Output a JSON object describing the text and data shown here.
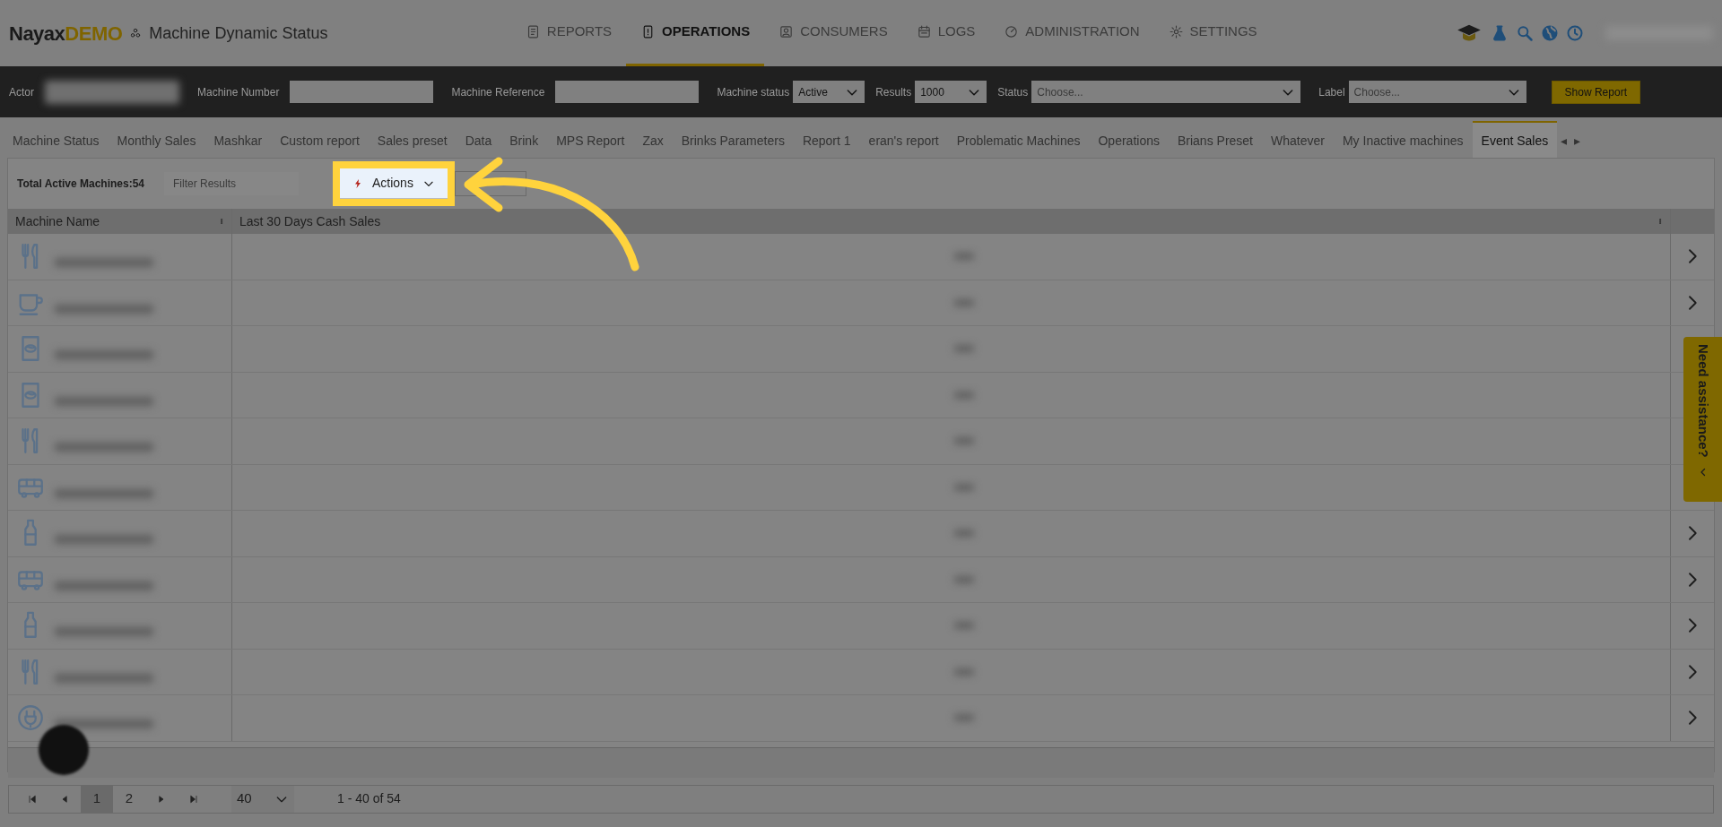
{
  "brand": {
    "name": "Nayax",
    "suffix": "DEMO"
  },
  "page_title": "Machine Dynamic Status",
  "nav": [
    {
      "label": "REPORTS",
      "kind": "doc",
      "selected": false
    },
    {
      "label": "OPERATIONS",
      "kind": "tablet",
      "selected": true
    },
    {
      "label": "CONSUMERS",
      "kind": "person",
      "selected": false
    },
    {
      "label": "LOGS",
      "kind": "calendar",
      "selected": false
    },
    {
      "label": "ADMINISTRATION",
      "kind": "gauge",
      "selected": false
    },
    {
      "label": "SETTINGS",
      "kind": "gear",
      "selected": false
    }
  ],
  "filters": {
    "actor_label": "Actor",
    "machine_number_label": "Machine Number",
    "machine_reference_label": "Machine Reference",
    "machine_status_label": "Machine status",
    "machine_status_value": "Active",
    "results_label": "Results",
    "results_value": "1000",
    "status_label": "Status",
    "status_placeholder": "Choose...",
    "label_label": "Label",
    "label_placeholder": "Choose...",
    "show_report": "Show Report"
  },
  "tabs": [
    {
      "label": "Machine Status",
      "selected": false
    },
    {
      "label": "Monthly Sales",
      "selected": false
    },
    {
      "label": "Mashkar",
      "selected": false
    },
    {
      "label": "Custom report",
      "selected": false
    },
    {
      "label": "Sales preset",
      "selected": false
    },
    {
      "label": "Data",
      "selected": false
    },
    {
      "label": "Brink",
      "selected": false
    },
    {
      "label": "MPS Report",
      "selected": false
    },
    {
      "label": "Zax",
      "selected": false
    },
    {
      "label": "Brinks Parameters",
      "selected": false
    },
    {
      "label": "Report 1",
      "selected": false
    },
    {
      "label": "eran's report",
      "selected": false
    },
    {
      "label": "Problematic Machines",
      "selected": false
    },
    {
      "label": "Operations",
      "selected": false
    },
    {
      "label": "Brians Preset",
      "selected": false
    },
    {
      "label": "Whatever",
      "selected": false
    },
    {
      "label": "My Inactive machines",
      "selected": false
    },
    {
      "label": "Event Sales",
      "selected": true
    }
  ],
  "tab_scroll": [
    "◂",
    "▸"
  ],
  "toolbar": {
    "total": "Total Active Machines:54",
    "filter_placeholder": "Filter Results",
    "actions": "Actions"
  },
  "table": {
    "columns": [
      "Machine Name",
      "Last 30 Days Cash Sales"
    ],
    "rows": [
      {
        "kind": "food"
      },
      {
        "kind": "coffee"
      },
      {
        "kind": "snack"
      },
      {
        "kind": "snack"
      },
      {
        "kind": "food"
      },
      {
        "kind": "bus"
      },
      {
        "kind": "bottle"
      },
      {
        "kind": "bus"
      },
      {
        "kind": "bottle"
      },
      {
        "kind": "food"
      },
      {
        "kind": "plug"
      }
    ]
  },
  "pager": {
    "pages": [
      {
        "label": "1",
        "selected": true
      },
      {
        "label": "2",
        "selected": false
      }
    ],
    "page_size": "40",
    "range": "1 - 40 of 54"
  },
  "assistance": "Need assistance?"
}
